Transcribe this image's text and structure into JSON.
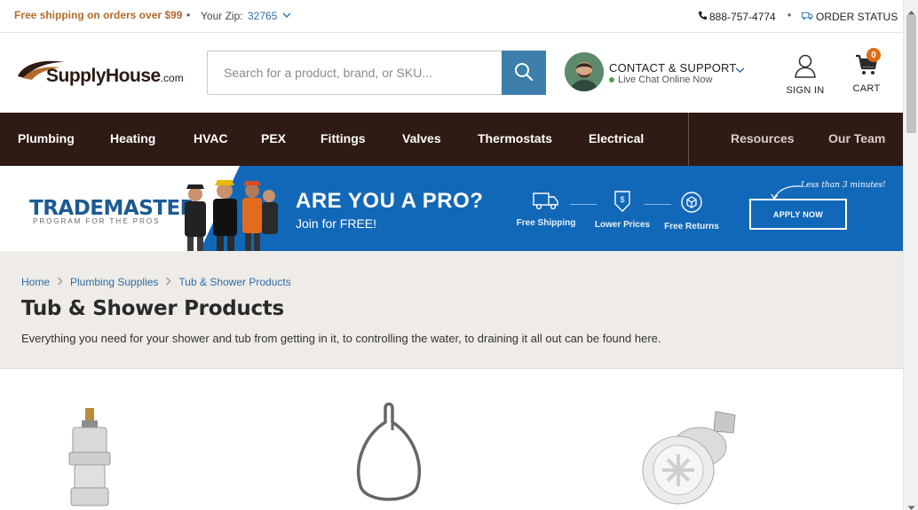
{
  "topbar": {
    "shipping": "Free shipping on orders over $99",
    "zip_label": "Your Zip:",
    "zip_value": "32765",
    "phone": "888-757-4774",
    "order_status": "ORDER STATUS"
  },
  "header": {
    "logo_text": "SupplyHouse",
    "logo_suffix": ".com",
    "search_placeholder": "Search for a product, brand, or SKU...",
    "contact_title": "CONTACT & SUPPORT",
    "live_chat": "Live Chat Online Now",
    "signin": "SIGN IN",
    "cart": "CART",
    "cart_count": "0"
  },
  "nav": {
    "items": [
      "Plumbing",
      "Heating",
      "HVAC",
      "PEX",
      "Fittings",
      "Valves",
      "Thermostats",
      "Electrical"
    ],
    "secondary": [
      "Resources",
      "Our Team"
    ]
  },
  "banner": {
    "logo_main": "TRADEMASTER",
    "logo_sub": "PROGRAM FOR THE PROS",
    "headline": "ARE YOU A PRO?",
    "subline": "Join for FREE!",
    "perks": [
      "Free Shipping",
      "Lower Prices",
      "Free Returns"
    ],
    "note": "Less than 3 minutes!",
    "apply": "APPLY NOW"
  },
  "category": {
    "breadcrumb": [
      "Home",
      "Plumbing Supplies",
      "Tub & Shower Products"
    ],
    "title": "Tub & Shower Products",
    "description": "Everything you need for your shower and tub from getting in it, to controlling the water, to draining it all out can be found here."
  },
  "colors": {
    "brand_brown": "#2f1a14",
    "accent_orange": "#b36b2c",
    "link_blue": "#2d6ea8",
    "banner_blue": "#1268b8",
    "search_button": "#3d7eab"
  }
}
